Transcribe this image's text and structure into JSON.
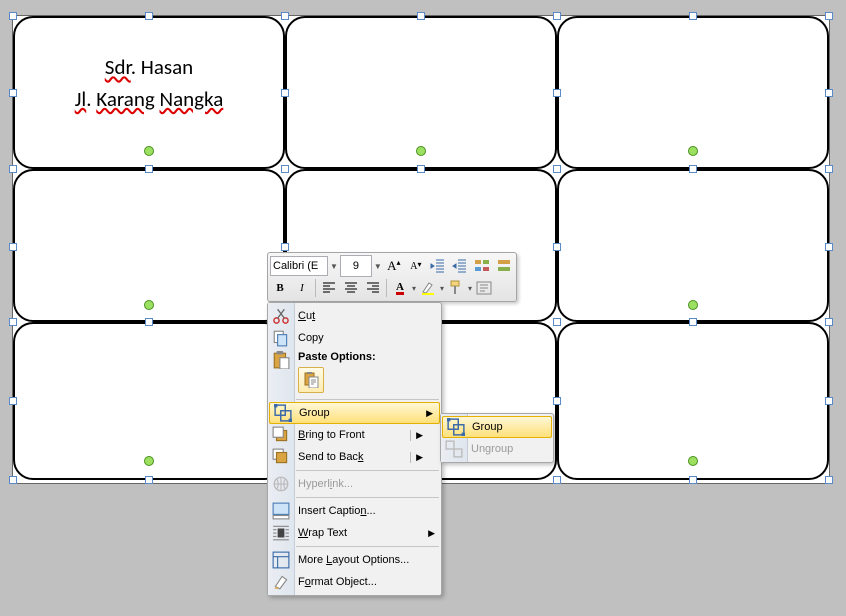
{
  "card": {
    "line1": "Sdr. Hasan",
    "line1_parts": {
      "a": "Sdr",
      "b": ". Hasan"
    },
    "line2": "Jl. Karang Nangka",
    "line2_parts": {
      "a": "Jl",
      "b": ". ",
      "c": "Karang",
      "d": " ",
      "e": "Nangka"
    }
  },
  "toolbar": {
    "font_name": "Calibri (E",
    "font_size": "9"
  },
  "context_menu": {
    "cut": "Cut",
    "copy": "Copy",
    "paste_options": "Paste Options:",
    "group": "Group",
    "bring_to_front": "Bring to Front",
    "send_to_back": "Send to Back",
    "hyperlink": "Hyperlink...",
    "insert_caption": "Insert Caption...",
    "wrap_text": "Wrap Text",
    "more_layout": "More Layout Options...",
    "format_object": "Format Object..."
  },
  "submenu": {
    "group": "Group",
    "ungroup": "Ungroup"
  }
}
